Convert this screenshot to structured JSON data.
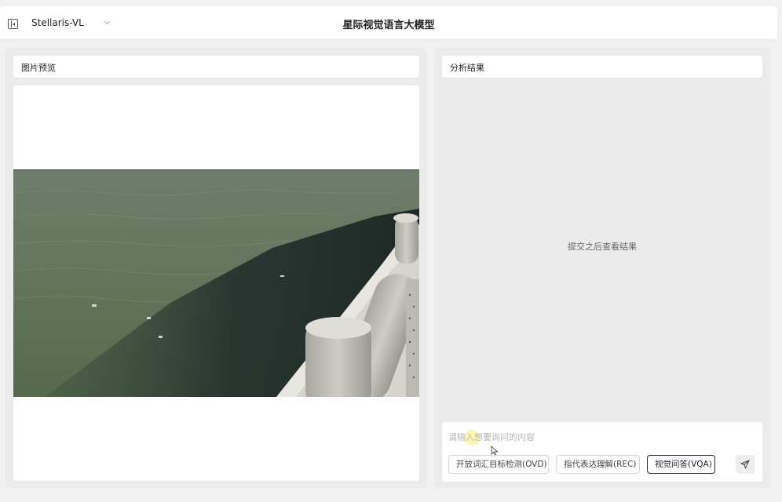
{
  "header": {
    "model_name": "Stellaris-VL",
    "title": "星际视觉语言大模型",
    "icons": {
      "sidebar_toggle": "sidebar-toggle-icon",
      "model_select": "chevron-down-icon"
    }
  },
  "left_panel": {
    "title": "图片预览",
    "image_description": "lake water beside a stone balustrade"
  },
  "right_panel": {
    "title": "分析结果",
    "empty_text": "提交之后查看结果",
    "input": {
      "placeholder": "请输入想要询问的内容",
      "value": ""
    },
    "modes": [
      {
        "label": "开放词汇目标检测(OVD)",
        "selected": false
      },
      {
        "label": "指代表达理解(REC)",
        "selected": false
      },
      {
        "label": "视觉问答(VQA)",
        "selected": true
      }
    ],
    "send_icon": "send-icon"
  },
  "colors": {
    "background": "#f1f1f2",
    "panel": "#ebebec",
    "selected_border": "#2a2d3a"
  }
}
